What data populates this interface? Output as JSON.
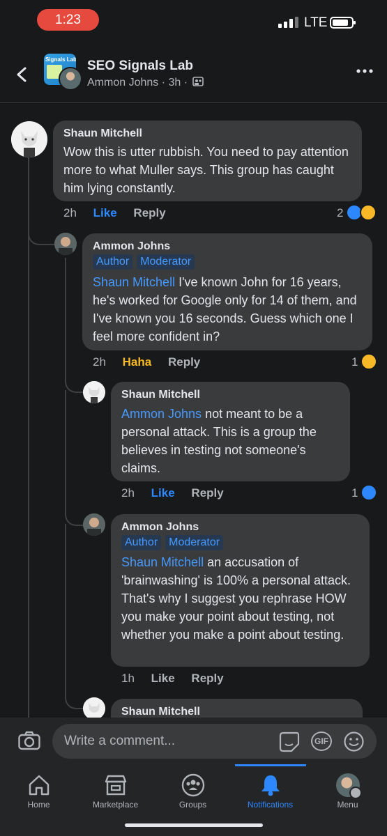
{
  "status_bar": {
    "time": "1:23",
    "network": "LTE"
  },
  "header": {
    "group_thumb_text": "Signals Lab",
    "title": "SEO Signals Lab",
    "subtitle": "Ammon Johns · 3h ·"
  },
  "comments": [
    {
      "author": "Shaun Mitchell",
      "body": "Wow this is utter rubbish. You need to pay attention more to what Muller says. This group has caught him lying constantly.",
      "time": "2h",
      "action_1": "Like",
      "action_2": "Reply",
      "reaction_count": "2",
      "reactions": [
        "like-icon",
        "haha-icon"
      ]
    },
    {
      "author": "Ammon Johns",
      "tags": [
        "Author",
        "Moderator"
      ],
      "mention": "Shaun Mitchell",
      "body": " I've known John for 16 years, he's worked for Google only for 14 of them, and I've known you 16 seconds. Guess which one I feel more confident in?",
      "time": "2h",
      "action_1": "Haha",
      "action_2": "Reply",
      "reaction_count": "1",
      "reactions": [
        "haha-icon"
      ]
    },
    {
      "author": "Shaun Mitchell",
      "mention": "Ammon Johns",
      "body": " not meant to be a personal attack. This is a group the believes in testing not someone's claims.",
      "time": "2h",
      "action_1": "Like",
      "action_2": "Reply",
      "reaction_count": "1",
      "reactions": [
        "like-icon"
      ]
    },
    {
      "author": "Ammon Johns",
      "tags": [
        "Author",
        "Moderator"
      ],
      "mention": "Shaun Mitchell",
      "body": " an accusation of 'brainwashing' is 100% a personal attack.  That's why I suggest you rephrase HOW you make your point about testing, not whether you make a point about testing.",
      "time": "1h",
      "action_1": "Like",
      "action_2": "Reply"
    },
    {
      "author": "Shaun Mitchell"
    }
  ],
  "composer": {
    "placeholder": "Write a comment...",
    "gif_label": "GIF"
  },
  "tabs": [
    {
      "label": "Home"
    },
    {
      "label": "Marketplace"
    },
    {
      "label": "Groups"
    },
    {
      "label": "Notifications"
    },
    {
      "label": "Menu"
    }
  ],
  "colors": {
    "accent": "#2d88ff",
    "haha": "#f7b928",
    "status_pill": "#e64a3e"
  }
}
